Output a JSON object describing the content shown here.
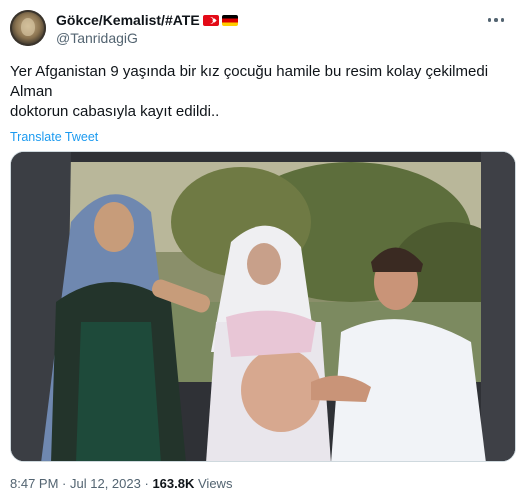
{
  "author": {
    "display_name": "Gökce/Kemalist/#ATE",
    "handle": "@TanridagiG",
    "flags": [
      "turkey-flag",
      "germany-flag"
    ]
  },
  "tweet": {
    "text_lines": [
      "Yer Afganistan 9 yaşında bir kız çocuğu hamile bu resim kolay çekilmedi",
      "Alman",
      "doktorun cabasıyla kayıt edildi.."
    ],
    "translate_label": "Translate Tweet"
  },
  "meta": {
    "time": "8:47 PM",
    "separator": "·",
    "date": "Jul 12, 2023",
    "views_count": "163.8K",
    "views_label": "Views"
  },
  "colors": {
    "accent": "#1d9bf0",
    "secondary_text": "#536471",
    "primary_text": "#0f1419"
  }
}
